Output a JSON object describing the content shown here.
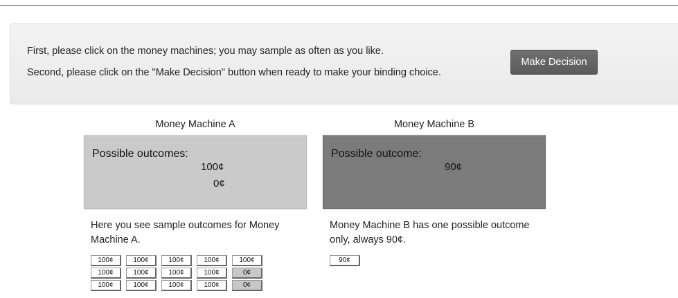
{
  "instructions": {
    "line1": "First, please click on the money machines; you may sample as often as you like.",
    "line2": "Second, please click on the \"Make Decision\" button when ready to make your binding choice.",
    "decision_button": "Make Decision"
  },
  "machine_a": {
    "title": "Money Machine A",
    "outcomes_label": "Possible outcomes:",
    "outcomes": [
      "100¢",
      "0¢"
    ],
    "description": "Here you see sample outcomes for Money Machine A.",
    "samples": [
      [
        "100¢",
        "100¢",
        "100¢",
        "100¢",
        "100¢"
      ],
      [
        "100¢",
        "100¢",
        "100¢",
        "100¢",
        "0¢"
      ],
      [
        "100¢",
        "100¢",
        "100¢",
        "100¢",
        "0¢"
      ]
    ]
  },
  "machine_b": {
    "title": "Money Machine B",
    "outcomes_label": "Possible outcome:",
    "outcomes": [
      "90¢"
    ],
    "description": "Money Machine B has one possible outcome only, always 90¢.",
    "samples": [
      [
        "90¢"
      ]
    ]
  },
  "colors": {
    "machine_a_bg": "#cacaca",
    "machine_b_bg": "#7b7b7b",
    "button_bg": "#5f5f5f"
  }
}
